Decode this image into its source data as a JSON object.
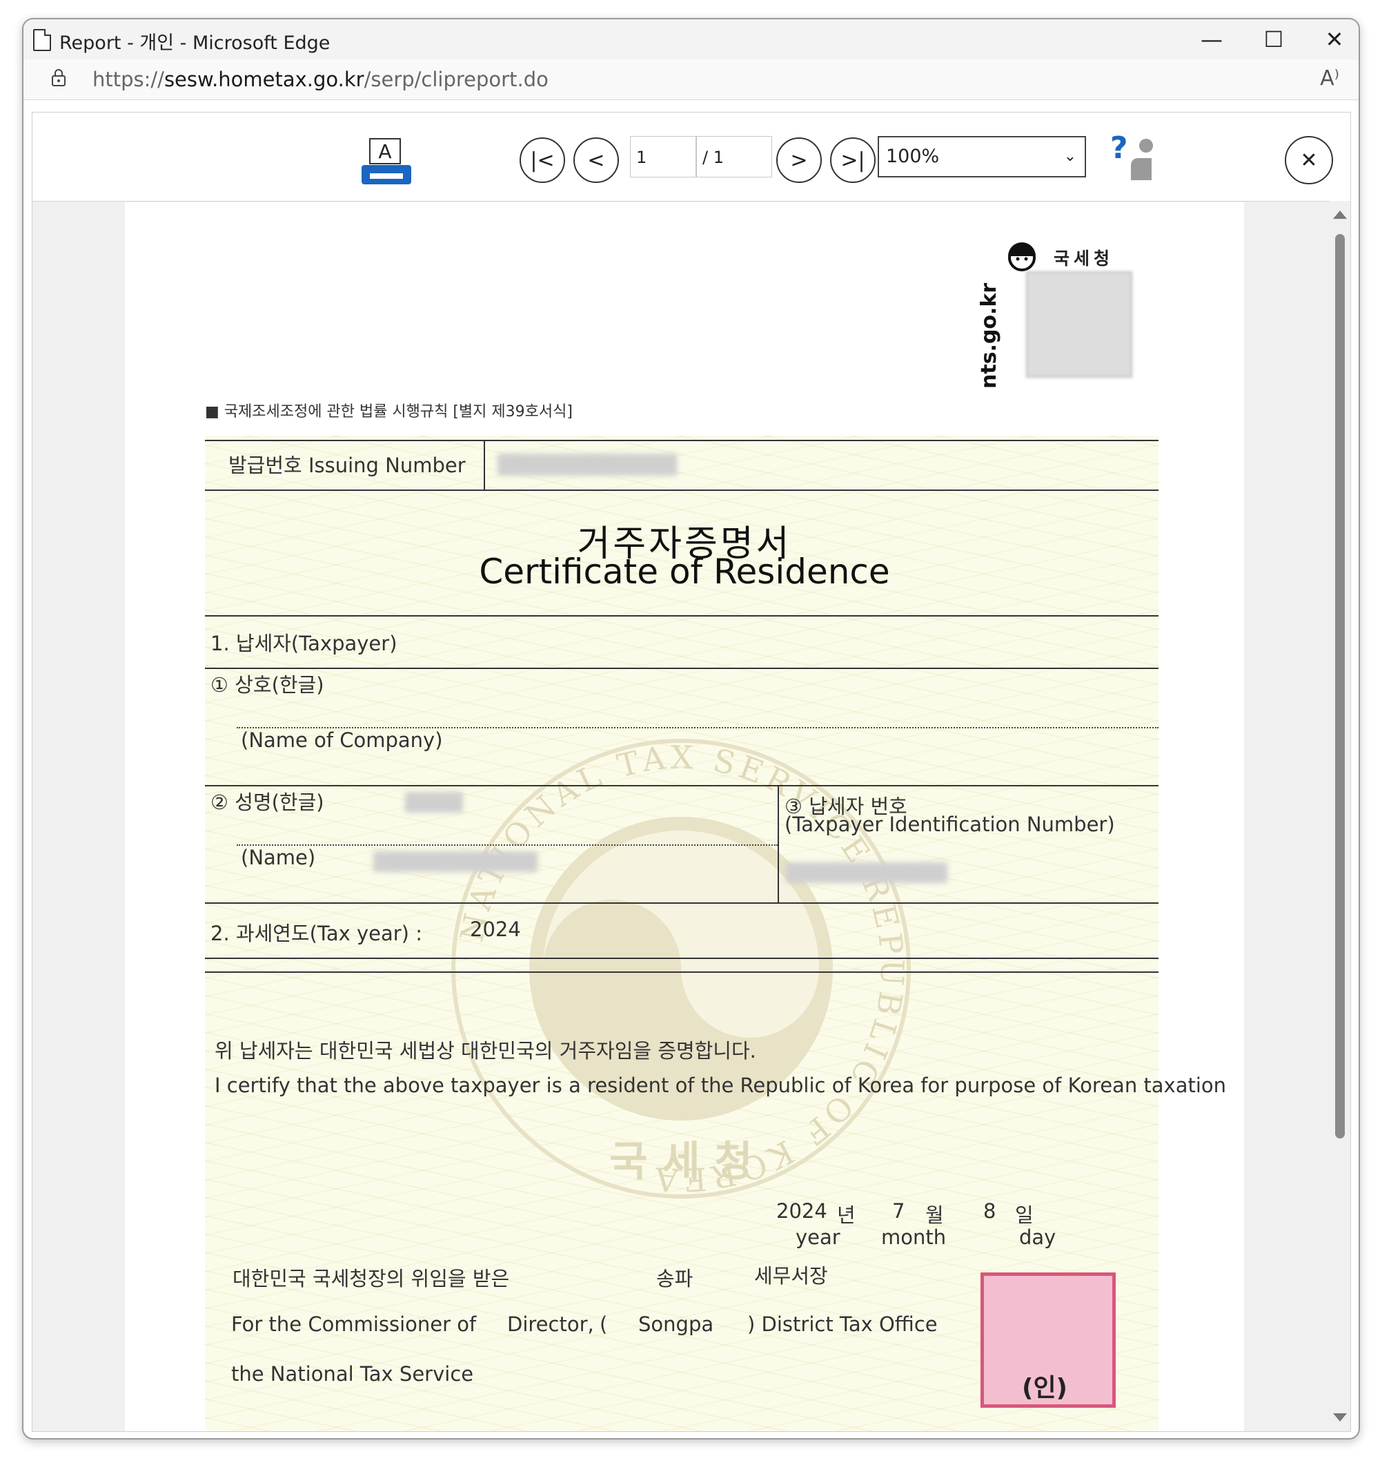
{
  "window": {
    "title": "Report - 개인 - Microsoft Edge",
    "url_prefix": "https://",
    "url_host": "sesw.hometax.go.kr",
    "url_path": "/serp/clipreport.do",
    "minimize_glyph": "—",
    "maximize_glyph": "☐",
    "close_glyph": "✕",
    "read_aloud_glyph": "A⁾"
  },
  "toolbar": {
    "print_glyph": "A",
    "first_glyph": "|<",
    "prev_glyph": "<",
    "current_page": "1",
    "total_pages": "/ 1",
    "next_glyph": ">",
    "last_glyph": ">|",
    "zoom": "100%",
    "help_glyph": "?",
    "close_glyph": "✕"
  },
  "document": {
    "logo_name": "국세청",
    "logo_url": "nts.go.kr",
    "form_ref": "■ 국제조세조정에 관한 법률 시행규칙 [별지 제39호서식]",
    "issuing_label": "발급번호 Issuing Number",
    "title_ko": "거주자증명서",
    "title_en": "Certificate of Residence",
    "section1": "1. 납세자(Taxpayer)",
    "company_ko": "① 상호(한글)",
    "company_en": "(Name of Company)",
    "name_ko": "② 성명(한글)",
    "name_en": "(Name)",
    "tin_ko": "③ 납세자 번호",
    "tin_en": "(Taxpayer Identification Number)",
    "tax_year_label": "2. 과세연도(Tax year) :",
    "tax_year": "2024",
    "certify_ko": "위 납세자는 대한민국 세법상 대한민국의 거주자임을 증명합니다.",
    "certify_en": "I certify that the above taxpayer is a resident of the Republic of Korea for purpose of Korean taxation",
    "year": "2024",
    "year_ko": "년",
    "year_en": "year",
    "month": "7",
    "month_ko": "월",
    "month_en": "month",
    "day": "8",
    "day_ko": "일",
    "day_en": "day",
    "delegation_ko": "대한민국 국세청장의 위임을 받은",
    "office_ko": "송파",
    "director_ko": "세무서장",
    "for_commissioner": "For the Commissioner of",
    "director_en": "Director,",
    "paren_open": "(",
    "office_en": "Songpa",
    "district_office": ") District Tax Office",
    "nts_en": "the National Tax Service",
    "stamp_mark": "(인)",
    "watermark_ring": "NATIONAL TAX SERVICE REPUBLIC OF KOREA",
    "watermark_ko": "국 세 청"
  },
  "colors": {
    "accent_blue": "#1a66c0",
    "stamp_red": "#d8577a",
    "paper_tint": "#fbfbe9"
  }
}
